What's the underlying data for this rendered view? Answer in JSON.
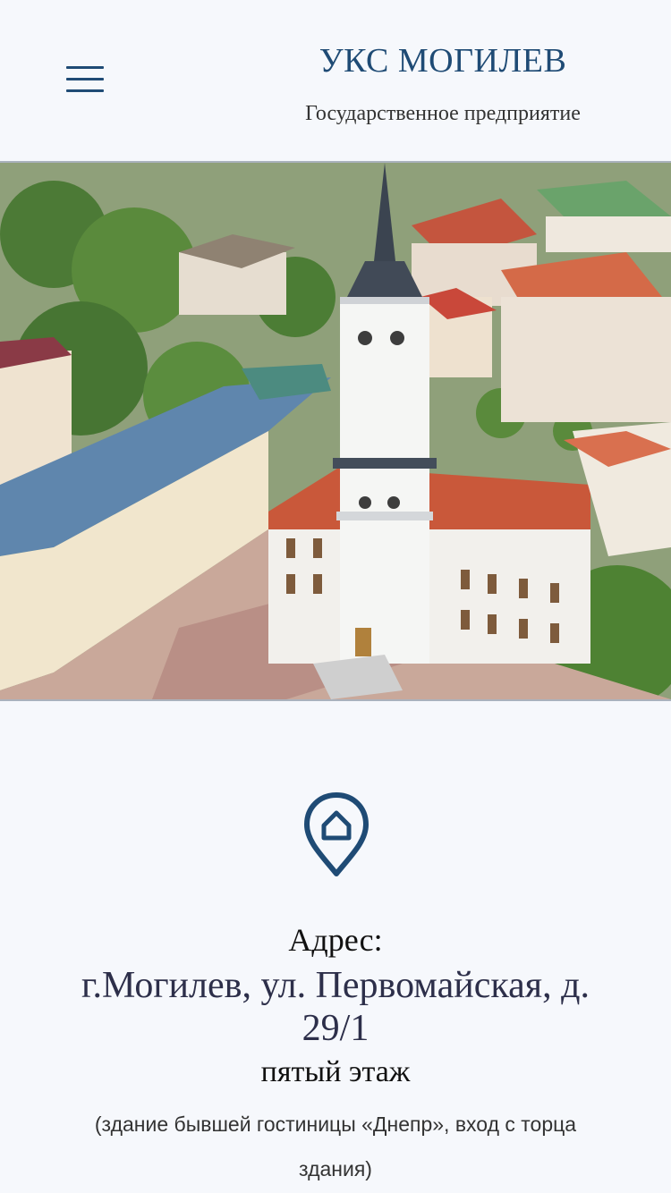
{
  "header": {
    "title": "УКС МОГИЛЕВ",
    "subtitle": "Государственное предприятие",
    "menu_icon": "hamburger-menu-icon"
  },
  "hero": {
    "image_alt": "Городская ратуша Могилева"
  },
  "address": {
    "icon": "location-pin-home-icon",
    "label": "Адрес:",
    "line": "г.Могилев, ул. Первомайская, д. 29/1",
    "floor": "пятый этаж",
    "note": "(здание бывшей гостиницы «Днепр», вход с торца здания)"
  },
  "colors": {
    "accent": "#1f4b75",
    "background": "#f6f8fc"
  }
}
